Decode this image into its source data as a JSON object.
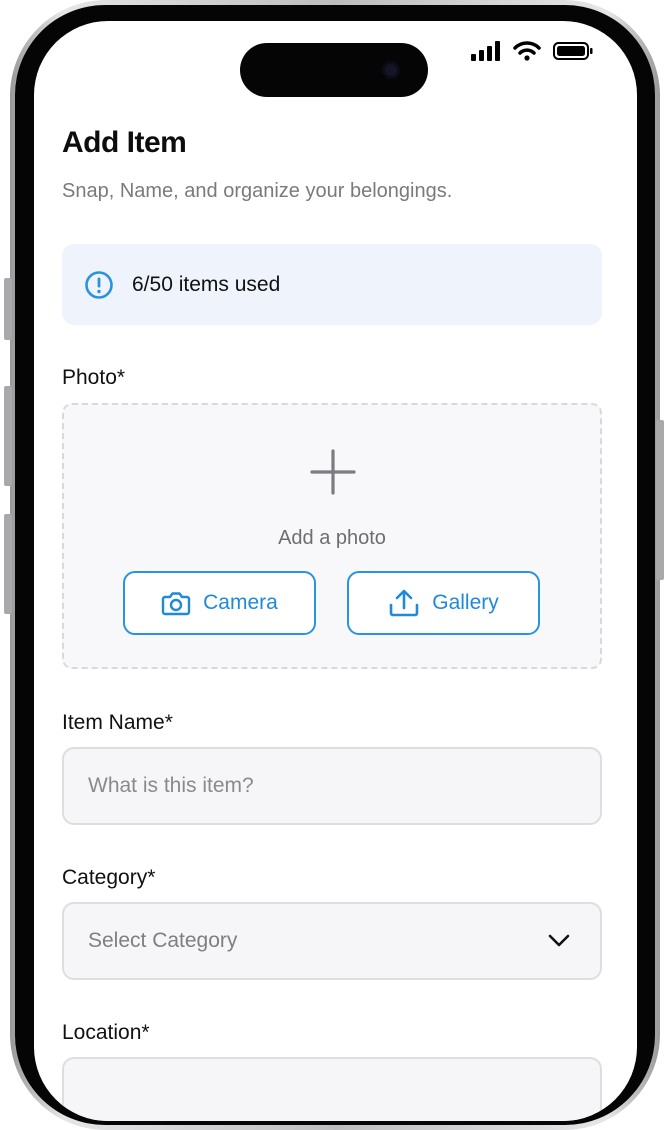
{
  "header": {
    "title": "Add Item",
    "subtitle": "Snap, Name, and organize your belongings."
  },
  "usage": {
    "text": "6/50 items used",
    "icon": "info-circle-icon",
    "accent": "#2a93de",
    "background": "#eef3fc"
  },
  "photo": {
    "label": "Photo*",
    "add_text": "Add a photo",
    "camera_label": "Camera",
    "gallery_label": "Gallery",
    "accent": "#2a93de"
  },
  "item_name": {
    "label": "Item Name*",
    "placeholder": "What is this item?",
    "value": ""
  },
  "category": {
    "label": "Category*",
    "placeholder": "Select Category"
  },
  "location": {
    "label": "Location*"
  },
  "status_bar": {
    "signal": "signal-bars-icon",
    "wifi": "wifi-icon",
    "battery": "battery-icon"
  }
}
